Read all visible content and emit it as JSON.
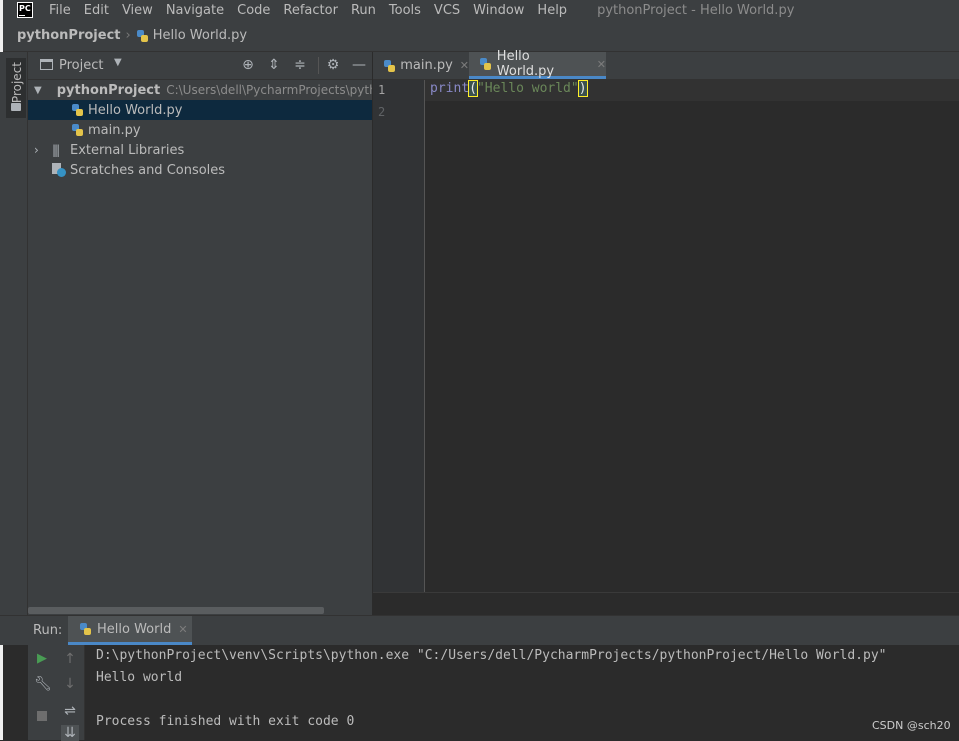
{
  "app": {
    "logo_text": "PC",
    "window_title": "pythonProject - Hello World.py"
  },
  "menu": [
    "File",
    "Edit",
    "View",
    "Navigate",
    "Code",
    "Refactor",
    "Run",
    "Tools",
    "VCS",
    "Window",
    "Help"
  ],
  "breadcrumb": {
    "project": "pythonProject",
    "file": "Hello World.py"
  },
  "left_strip": {
    "project_label": "Project"
  },
  "project_panel": {
    "title": "Project",
    "tree": [
      {
        "label": "pythonProject",
        "path": "C:\\Users\\dell\\PycharmProjects\\pytho"
      },
      {
        "label": "Hello World.py"
      },
      {
        "label": "main.py"
      },
      {
        "label": "External Libraries"
      },
      {
        "label": "Scratches and Consoles"
      }
    ]
  },
  "editor": {
    "tabs": [
      {
        "label": "main.py",
        "active": false
      },
      {
        "label": "Hello World.py",
        "active": true
      }
    ],
    "line_numbers": [
      "1",
      "2"
    ],
    "code": {
      "func": "print",
      "open_paren": "(",
      "string": "\"Hello world\"",
      "close_paren": ")"
    }
  },
  "run_panel": {
    "label": "Run:",
    "tab_label": "Hello World",
    "console": [
      "D:\\pythonProject\\venv\\Scripts\\python.exe \"C:/Users/dell/PycharmProjects/pythonProject/Hello World.py\"",
      "Hello world",
      "",
      "Process finished with exit code 0"
    ]
  },
  "watermark": "CSDN @sch20",
  "colors": {
    "accent": "#4a88c7",
    "selection": "#0d293e",
    "string": "#6a8759",
    "func": "#8888c6",
    "run_green": "#499c54"
  }
}
